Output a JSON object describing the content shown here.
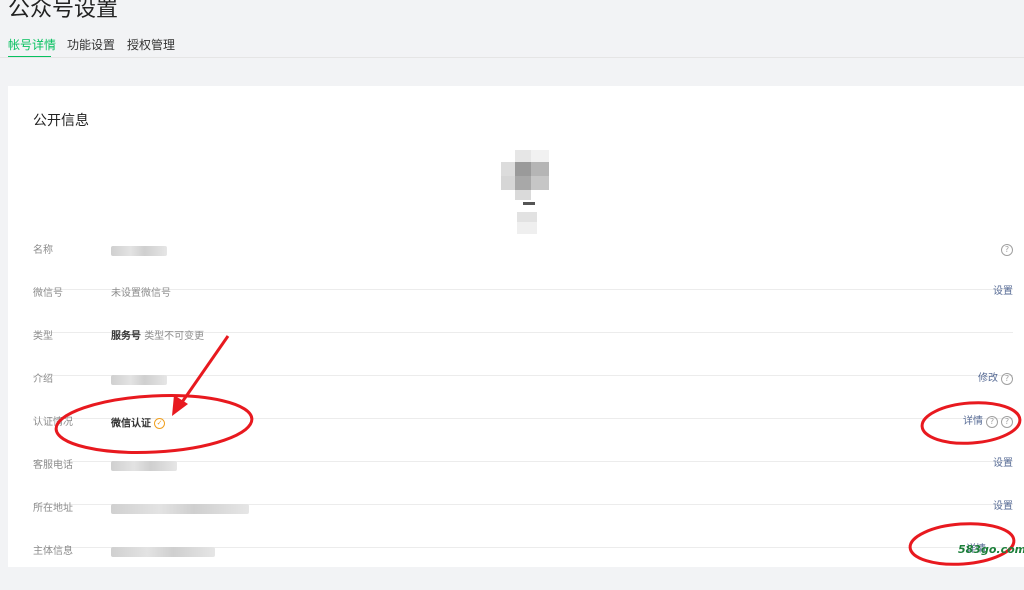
{
  "page": {
    "title": "公众号设置"
  },
  "tabs": [
    {
      "label": "帐号详情",
      "active": true
    },
    {
      "label": "功能设置",
      "active": false
    },
    {
      "label": "授权管理",
      "active": false
    }
  ],
  "section": {
    "title": "公开信息"
  },
  "rows": {
    "name": {
      "label": "名称"
    },
    "wechat_id": {
      "label": "微信号",
      "value": "未设置微信号",
      "action": "设置"
    },
    "type": {
      "label": "类型",
      "value": "服务号",
      "note": "类型不可变更"
    },
    "intro": {
      "label": "介绍",
      "action": "修改"
    },
    "verification": {
      "label": "认证情况",
      "value": "微信认证",
      "action": "详情"
    },
    "phone": {
      "label": "客服电话",
      "action": "设置"
    },
    "address": {
      "label": "所在地址",
      "action": "设置"
    },
    "entity": {
      "label": "主体信息",
      "action": "详情"
    }
  },
  "icons": {
    "help": "question-circle-icon",
    "verified": "check-circle-icon"
  },
  "watermark": {
    "text": "583go.com"
  },
  "colors": {
    "accent": "#07c160",
    "link": "#576b95",
    "verified": "#f0a020",
    "annotation": "#e8191f"
  }
}
